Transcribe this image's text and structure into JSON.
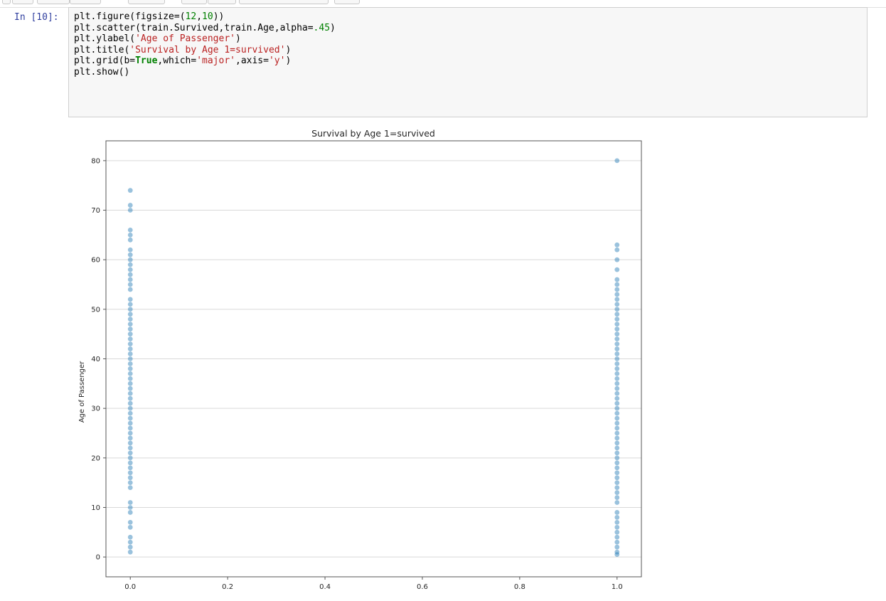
{
  "cell": {
    "prompt": "In [10]:",
    "lines": [
      [
        {
          "t": "plt.figure(figsize=(",
          "c": ""
        },
        {
          "t": "12",
          "c": "tk-num"
        },
        {
          "t": ",",
          "c": ""
        },
        {
          "t": "10",
          "c": "tk-num"
        },
        {
          "t": "))",
          "c": ""
        }
      ],
      [
        {
          "t": "plt.scatter(train.Survived,train.Age,alpha=",
          "c": ""
        },
        {
          "t": ".45",
          "c": "tk-num"
        },
        {
          "t": ")",
          "c": ""
        }
      ],
      [
        {
          "t": "plt.ylabel(",
          "c": ""
        },
        {
          "t": "'Age of Passenger'",
          "c": "tk-str"
        },
        {
          "t": ")",
          "c": ""
        }
      ],
      [
        {
          "t": "plt.title(",
          "c": ""
        },
        {
          "t": "'Survival by Age 1=survived'",
          "c": "tk-str"
        },
        {
          "t": ")",
          "c": ""
        }
      ],
      [
        {
          "t": "plt.grid(b=",
          "c": ""
        },
        {
          "t": "True",
          "c": "tk-kw"
        },
        {
          "t": ",which=",
          "c": ""
        },
        {
          "t": "'major'",
          "c": "tk-str"
        },
        {
          "t": ",axis=",
          "c": ""
        },
        {
          "t": "'y'",
          "c": "tk-str"
        },
        {
          "t": ")",
          "c": ""
        }
      ],
      [
        {
          "t": "plt.show()",
          "c": ""
        }
      ]
    ]
  },
  "chart_data": {
    "type": "scatter",
    "title": "Survival by Age 1=survived",
    "xlabel": "",
    "ylabel": "Age of Passenger",
    "xlim": [
      -0.05,
      1.05
    ],
    "ylim": [
      -4,
      84
    ],
    "xticks": [
      "0.0",
      "0.2",
      "0.4",
      "0.6",
      "0.8",
      "1.0"
    ],
    "yticks": [
      "0",
      "10",
      "20",
      "30",
      "40",
      "50",
      "60",
      "70",
      "80"
    ],
    "grid": "major, y-axis",
    "color": "#1f77b4",
    "alpha": 0.45,
    "series": [
      {
        "x": 0,
        "values": [
          1,
          2,
          3,
          4,
          6,
          7,
          9,
          10,
          11,
          14,
          15,
          16,
          17,
          18,
          19,
          20,
          21,
          22,
          23,
          24,
          25,
          26,
          27,
          28,
          29,
          30,
          31,
          32,
          33,
          34,
          35,
          36,
          37,
          38,
          39,
          40,
          41,
          42,
          43,
          44,
          45,
          46,
          47,
          48,
          49,
          50,
          51,
          52,
          54,
          55,
          56,
          57,
          58,
          59,
          60,
          61,
          62,
          64,
          65,
          66,
          70,
          71,
          74
        ]
      },
      {
        "x": 1,
        "values": [
          0.5,
          1,
          2,
          3,
          4,
          5,
          6,
          7,
          8,
          9,
          11,
          12,
          13,
          14,
          15,
          16,
          17,
          18,
          19,
          20,
          21,
          22,
          23,
          24,
          25,
          26,
          27,
          28,
          29,
          30,
          31,
          32,
          33,
          34,
          35,
          36,
          37,
          38,
          39,
          40,
          41,
          42,
          43,
          44,
          45,
          46,
          47,
          48,
          49,
          50,
          51,
          52,
          53,
          54,
          55,
          56,
          58,
          60,
          62,
          63,
          80
        ]
      }
    ]
  }
}
